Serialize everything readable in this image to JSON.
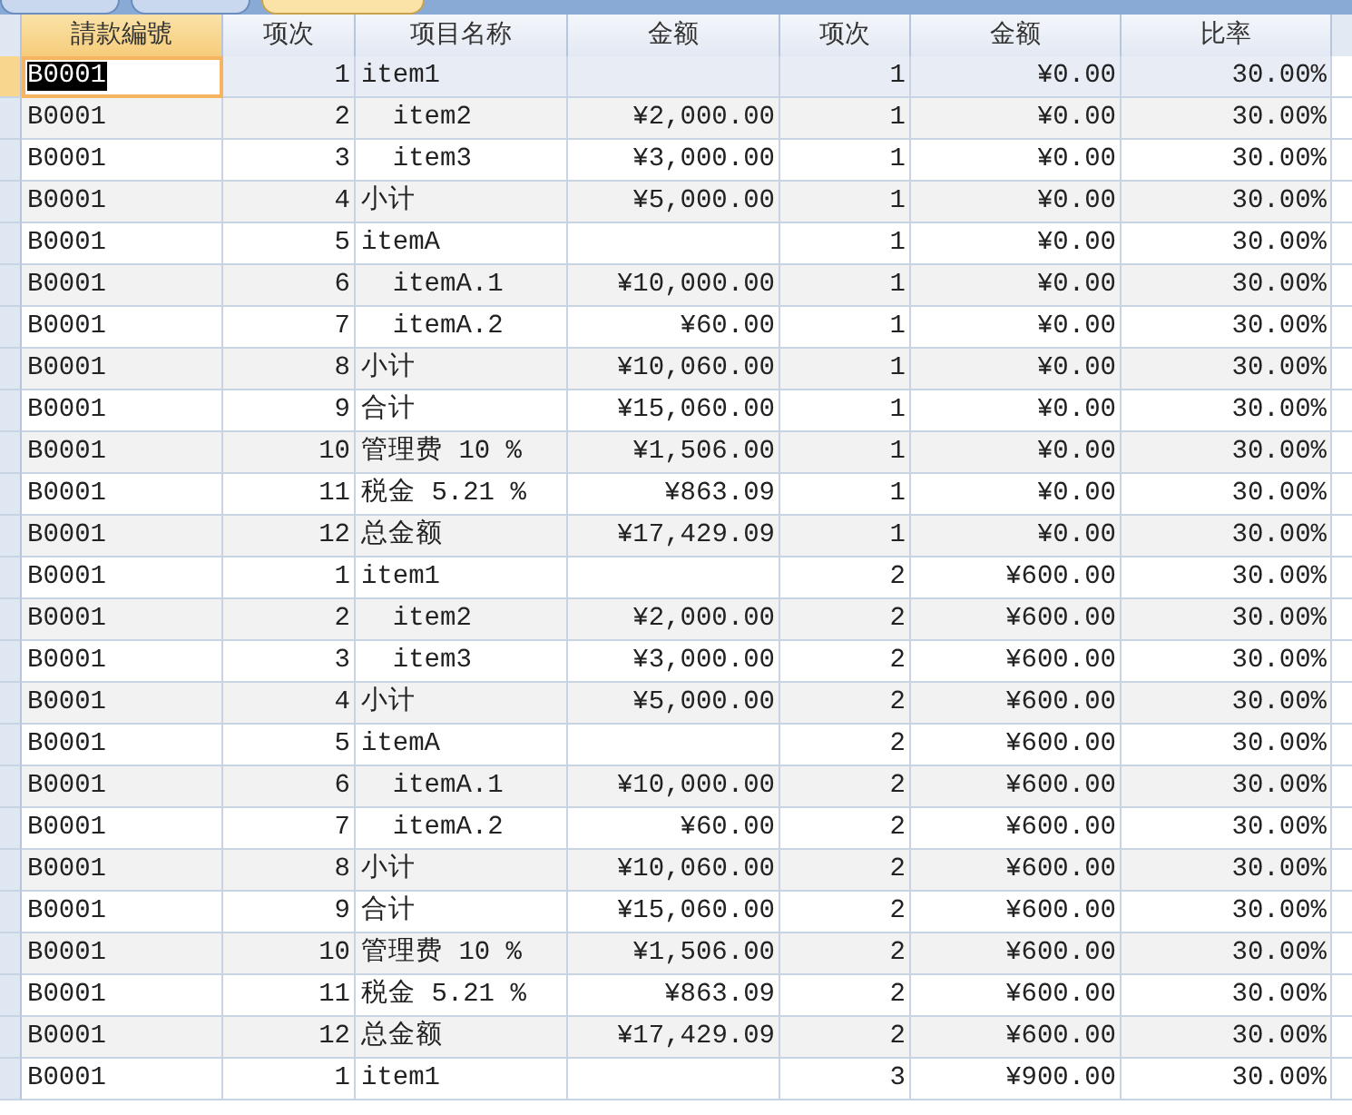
{
  "tabs": [
    {
      "selected": false
    },
    {
      "selected": false
    },
    {
      "selected": true
    }
  ],
  "table": {
    "columns": [
      {
        "label": "請款編號",
        "selected": true
      },
      {
        "label": "项次",
        "selected": false
      },
      {
        "label": "项目名称",
        "selected": false
      },
      {
        "label": "金额",
        "selected": false
      },
      {
        "label": "项次",
        "selected": false
      },
      {
        "label": "金额",
        "selected": false
      },
      {
        "label": "比率",
        "selected": false
      }
    ],
    "rows": [
      {
        "selected": true,
        "cells": [
          "B0001",
          "1",
          "item1",
          "",
          "1",
          "¥0.00",
          "30.00%"
        ]
      },
      {
        "selected": false,
        "cells": [
          "B0001",
          "2",
          "  item2",
          "¥2,000.00",
          "1",
          "¥0.00",
          "30.00%"
        ]
      },
      {
        "selected": false,
        "cells": [
          "B0001",
          "3",
          "  item3",
          "¥3,000.00",
          "1",
          "¥0.00",
          "30.00%"
        ]
      },
      {
        "selected": false,
        "cells": [
          "B0001",
          "4",
          "小计",
          "¥5,000.00",
          "1",
          "¥0.00",
          "30.00%"
        ]
      },
      {
        "selected": false,
        "cells": [
          "B0001",
          "5",
          "itemA",
          "",
          "1",
          "¥0.00",
          "30.00%"
        ]
      },
      {
        "selected": false,
        "cells": [
          "B0001",
          "6",
          "  itemA.1",
          "¥10,000.00",
          "1",
          "¥0.00",
          "30.00%"
        ]
      },
      {
        "selected": false,
        "cells": [
          "B0001",
          "7",
          "  itemA.2",
          "¥60.00",
          "1",
          "¥0.00",
          "30.00%"
        ]
      },
      {
        "selected": false,
        "cells": [
          "B0001",
          "8",
          "小计",
          "¥10,060.00",
          "1",
          "¥0.00",
          "30.00%"
        ]
      },
      {
        "selected": false,
        "cells": [
          "B0001",
          "9",
          "合计",
          "¥15,060.00",
          "1",
          "¥0.00",
          "30.00%"
        ]
      },
      {
        "selected": false,
        "cells": [
          "B0001",
          "10",
          "管理费 10 %",
          "¥1,506.00",
          "1",
          "¥0.00",
          "30.00%"
        ]
      },
      {
        "selected": false,
        "cells": [
          "B0001",
          "11",
          "税金 5.21 %",
          "¥863.09",
          "1",
          "¥0.00",
          "30.00%"
        ]
      },
      {
        "selected": false,
        "cells": [
          "B0001",
          "12",
          "总金额",
          "¥17,429.09",
          "1",
          "¥0.00",
          "30.00%"
        ]
      },
      {
        "selected": false,
        "cells": [
          "B0001",
          "1",
          "item1",
          "",
          "2",
          "¥600.00",
          "30.00%"
        ]
      },
      {
        "selected": false,
        "cells": [
          "B0001",
          "2",
          "  item2",
          "¥2,000.00",
          "2",
          "¥600.00",
          "30.00%"
        ]
      },
      {
        "selected": false,
        "cells": [
          "B0001",
          "3",
          "  item3",
          "¥3,000.00",
          "2",
          "¥600.00",
          "30.00%"
        ]
      },
      {
        "selected": false,
        "cells": [
          "B0001",
          "4",
          "小计",
          "¥5,000.00",
          "2",
          "¥600.00",
          "30.00%"
        ]
      },
      {
        "selected": false,
        "cells": [
          "B0001",
          "5",
          "itemA",
          "",
          "2",
          "¥600.00",
          "30.00%"
        ]
      },
      {
        "selected": false,
        "cells": [
          "B0001",
          "6",
          "  itemA.1",
          "¥10,000.00",
          "2",
          "¥600.00",
          "30.00%"
        ]
      },
      {
        "selected": false,
        "cells": [
          "B0001",
          "7",
          "  itemA.2",
          "¥60.00",
          "2",
          "¥600.00",
          "30.00%"
        ]
      },
      {
        "selected": false,
        "cells": [
          "B0001",
          "8",
          "小计",
          "¥10,060.00",
          "2",
          "¥600.00",
          "30.00%"
        ]
      },
      {
        "selected": false,
        "cells": [
          "B0001",
          "9",
          "合计",
          "¥15,060.00",
          "2",
          "¥600.00",
          "30.00%"
        ]
      },
      {
        "selected": false,
        "cells": [
          "B0001",
          "10",
          "管理费 10 %",
          "¥1,506.00",
          "2",
          "¥600.00",
          "30.00%"
        ]
      },
      {
        "selected": false,
        "cells": [
          "B0001",
          "11",
          "税金 5.21 %",
          "¥863.09",
          "2",
          "¥600.00",
          "30.00%"
        ]
      },
      {
        "selected": false,
        "cells": [
          "B0001",
          "12",
          "总金额",
          "¥17,429.09",
          "2",
          "¥600.00",
          "30.00%"
        ]
      },
      {
        "selected": false,
        "cells": [
          "B0001",
          "1",
          "item1",
          "",
          "3",
          "¥900.00",
          "30.00%"
        ]
      }
    ]
  }
}
